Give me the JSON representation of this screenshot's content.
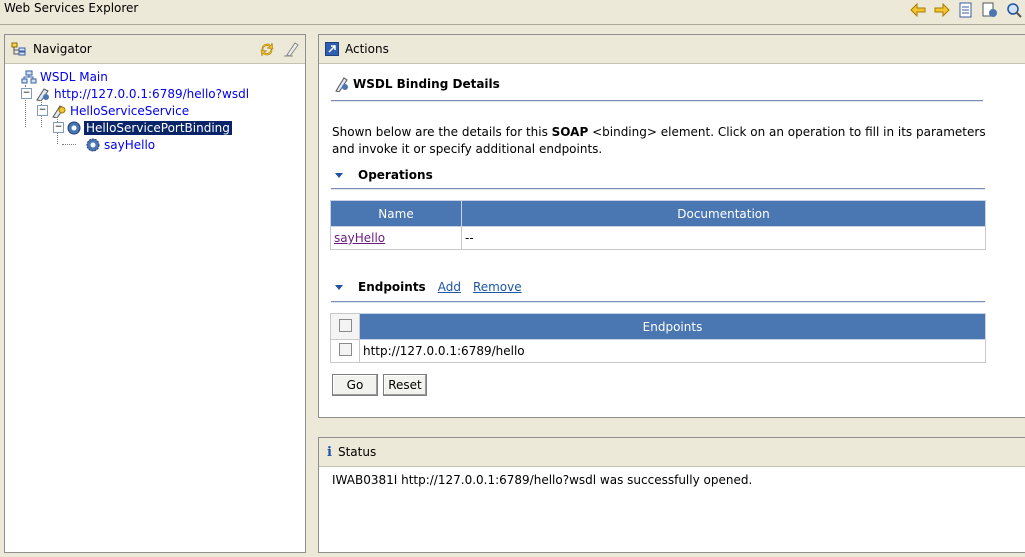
{
  "window": {
    "title": "Web Services Explorer"
  },
  "navigator": {
    "title": "Navigator",
    "tree": [
      {
        "label": "WSDL Main"
      },
      {
        "label": "http://127.0.0.1:6789/hello?wsdl"
      },
      {
        "label": "HelloServiceService"
      },
      {
        "label": "HelloServicePortBinding"
      },
      {
        "label": "sayHello"
      }
    ]
  },
  "actions": {
    "title": "Actions",
    "heading": "WSDL Binding Details",
    "description": {
      "before": "Shown below are the details for this ",
      "bold": "SOAP",
      "after": " <binding> element. Click on an operation to fill in its parameters and invoke it or specify additional endpoints."
    },
    "operations": {
      "title": "Operations",
      "columns": [
        "Name",
        "Documentation"
      ],
      "rows": [
        {
          "name": "sayHello",
          "documentation": "--"
        }
      ]
    },
    "endpoints": {
      "title": "Endpoints",
      "add_label": "Add",
      "remove_label": "Remove",
      "column": "Endpoints",
      "rows": [
        {
          "url": "http://127.0.0.1:6789/hello"
        }
      ]
    },
    "buttons": {
      "go": "Go",
      "reset": "Reset"
    }
  },
  "status": {
    "title": "Status",
    "message": "IWAB0381I http://127.0.0.1:6789/hello?wsdl was successfully opened."
  }
}
